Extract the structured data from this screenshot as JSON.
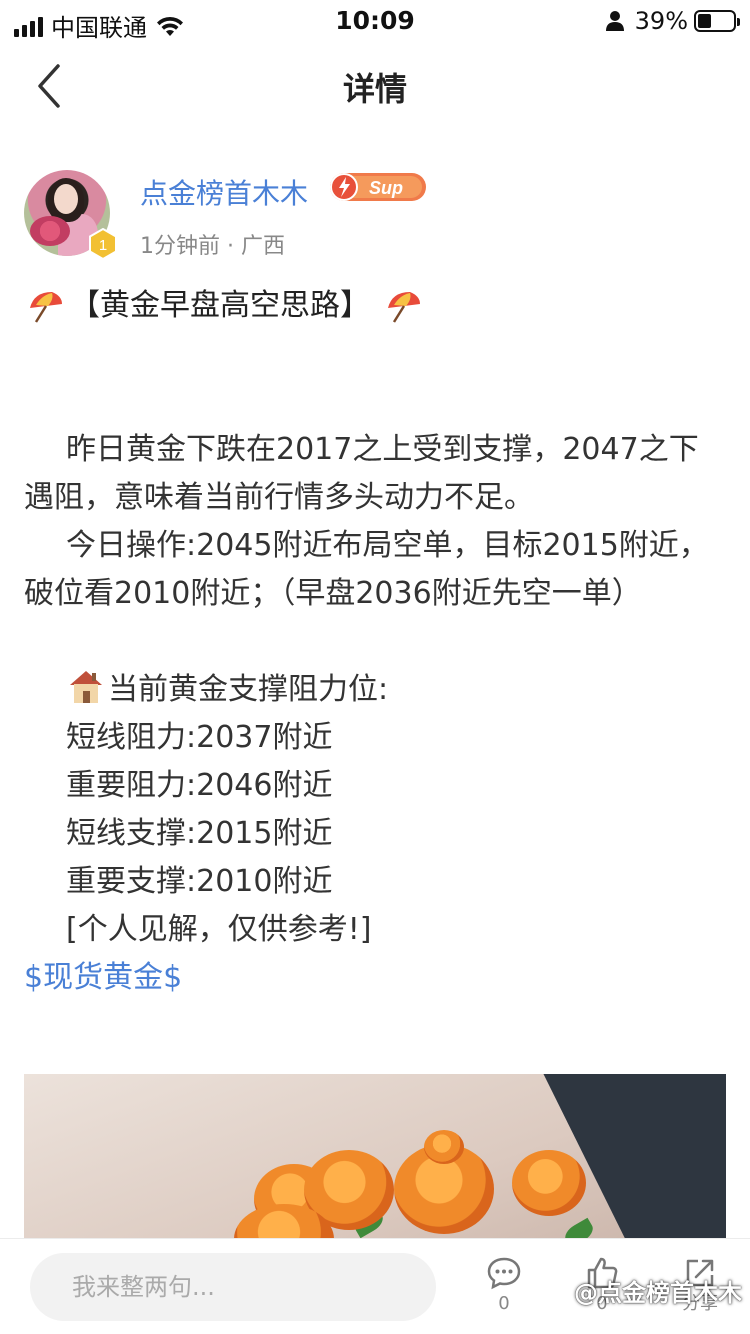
{
  "status_bar": {
    "carrier": "中国联通",
    "time": "10:09",
    "battery_percent": "39%",
    "battery_level": 0.39,
    "icons": [
      "signal-icon",
      "wifi-icon",
      "person-icon",
      "battery-icon"
    ]
  },
  "nav": {
    "title": "详情",
    "back_icon": "chevron-left-icon"
  },
  "author": {
    "name": "点金榜首木木",
    "level": "1",
    "badge_label": "Sup",
    "meta": "1分钟前 · 广西"
  },
  "post": {
    "title": "【黄金早盘高空思路】",
    "paragraph1": "昨日黄金下跌在2017之上受到支撑，2047之下遇阻，意味着当前行情多头动力不足。",
    "paragraph2": "今日操作:2045附近布局空单，目标2015附近，破位看2010附近；（早盘2036附近先空一单）",
    "levels_heading": "当前黄金支撑阻力位:",
    "levels": [
      "短线阻力:2037附近",
      "重要阻力:2046附近",
      "短线支撑:2015附近",
      "重要支撑:2010附近"
    ],
    "disclaimer": "[个人见解，仅供参考!]",
    "topic_tag": "$现货黄金$",
    "image_icon": "roses-photo"
  },
  "bottom_bar": {
    "comment_placeholder": "我来整两句...",
    "comment_count": "0",
    "like_count": "0",
    "share_label": "分享",
    "watermark": "@点金榜首木木"
  },
  "colors": {
    "link_blue": "#4a80d6",
    "text": "#333333",
    "meta_gray": "#888888",
    "input_bg": "#f2f2f2"
  }
}
